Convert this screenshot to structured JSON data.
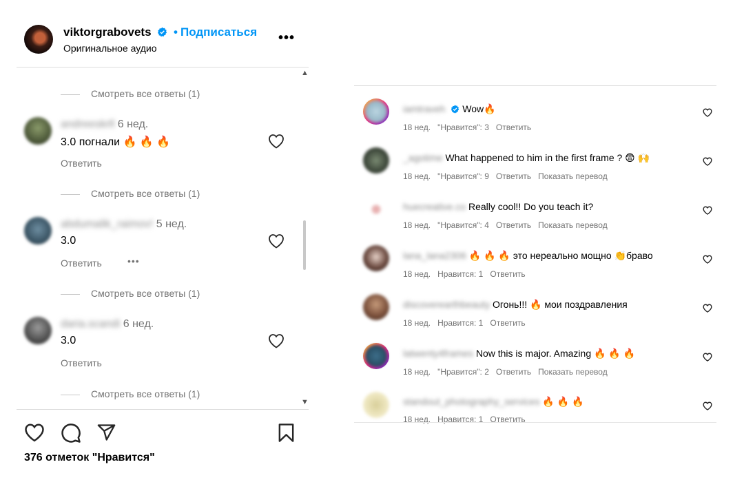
{
  "header": {
    "username": "viktorgrabovets",
    "separator": "•",
    "subscribe_label": "Подписаться",
    "subtitle": "Оригинальное аудио",
    "more_label": "•••"
  },
  "comments_left": {
    "view_replies": "Смотреть все ответы (1)",
    "reply_label": "Ответить",
    "more_label": "•••",
    "items": [
      {
        "username": "andreeskrll",
        "time": "6 нед.",
        "text": "3.0 погнали 🔥 🔥 🔥"
      },
      {
        "username": "abdumalik_raimov!",
        "time": "5 нед.",
        "text": "3.0"
      },
      {
        "username": "daria.scandi",
        "time": "6 нед.",
        "text": "3.0"
      }
    ]
  },
  "actions": {
    "likes": "376 отметок \"Нравится\""
  },
  "comments_right": {
    "items": [
      {
        "username": "iamtraveh",
        "text": "Wow🔥",
        "time": "18 нед.",
        "likes": "\"Нравится\": 3",
        "reply": "Ответить",
        "translate": ""
      },
      {
        "username": "_agotime",
        "text": "What happened to him in the first frame ? 😨 🙌",
        "time": "18 нед.",
        "likes": "\"Нравится\": 9",
        "reply": "Ответить",
        "translate": "Показать перевод"
      },
      {
        "username": "huecreative.co",
        "text": "Really cool!! Do you teach it?",
        "time": "18 нед.",
        "likes": "\"Нравится\": 4",
        "reply": "Ответить",
        "translate": "Показать перевод"
      },
      {
        "username": "lana_lana2306",
        "text": "🔥 🔥 🔥 это нереально мощно 👏браво",
        "time": "18 нед.",
        "likes": "Нравится: 1",
        "reply": "Ответить",
        "translate": ""
      },
      {
        "username": "discoverearthbeauty",
        "text": "Огонь!!! 🔥 мои поздравления",
        "time": "18 нед.",
        "likes": "Нравится: 1",
        "reply": "Ответить",
        "translate": ""
      },
      {
        "username": "latwenty4frames",
        "text": "Now this is major. Amazing 🔥 🔥 🔥",
        "time": "18 нед.",
        "likes": "\"Нравится\": 2",
        "reply": "Ответить",
        "translate": "Показать перевод"
      },
      {
        "username": "standout_photography_services",
        "text": "🔥 🔥 🔥",
        "time": "18 нед.",
        "likes": "Нравится: 1",
        "reply": "Ответить",
        "translate": ""
      }
    ]
  },
  "colors": {
    "accent": "#0095f6",
    "secondary_text": "#737373",
    "divider": "#dbdbdb",
    "fire": "#f4511e"
  }
}
